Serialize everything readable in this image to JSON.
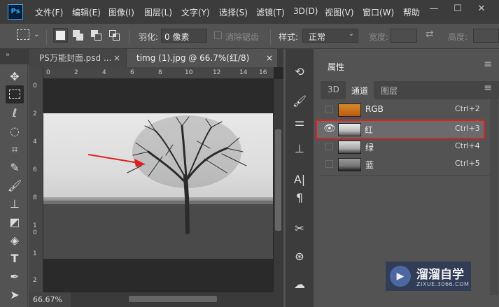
{
  "app": {
    "logo": "Ps"
  },
  "menu": {
    "items": [
      "文件(F)",
      "编辑(E)",
      "图像(I)",
      "图层(L)",
      "文字(Y)",
      "选择(S)",
      "滤镜(T)",
      "3D(D)",
      "视图(V)",
      "窗口(W)",
      "帮助"
    ]
  },
  "window_controls": {
    "minimize": "—",
    "restore": "☐",
    "close": "✕"
  },
  "options": {
    "feather_label": "羽化:",
    "feather_value": "0 像素",
    "antialias_label": "消除锯齿",
    "style_label": "样式:",
    "style_value": "正常",
    "width_label": "宽度:",
    "height_label": "高度:"
  },
  "tabs": [
    {
      "label": "PS万能封面.psd ...",
      "close": "×"
    },
    {
      "label": "timg (1).jpg @ 66.7%(红/8)",
      "close": "×"
    }
  ],
  "ruler": {
    "h": [
      "0",
      "2",
      "4",
      "6",
      "8",
      "10",
      "12",
      "14",
      "16"
    ],
    "v": [
      "0",
      "2",
      "4",
      "6",
      "8",
      "1",
      "0",
      "1",
      "2"
    ]
  },
  "status": {
    "zoom": "66.67%"
  },
  "panel": {
    "title": "属性",
    "tabs": [
      "3D",
      "通道",
      "图层"
    ],
    "channels": [
      {
        "name": "RGB",
        "shortcut": "Ctrl+2"
      },
      {
        "name": "红",
        "shortcut": "Ctrl+3"
      },
      {
        "name": "绿",
        "shortcut": "Ctrl+4"
      },
      {
        "name": "蓝",
        "shortcut": "Ctrl+5"
      }
    ]
  },
  "watermark": {
    "title": "溜溜自学",
    "subtitle": "ZIXUE.3066.COM"
  },
  "colors": {
    "selection_border": "#e02020",
    "arrow": "#e02020",
    "accent": "#31a8ff"
  }
}
